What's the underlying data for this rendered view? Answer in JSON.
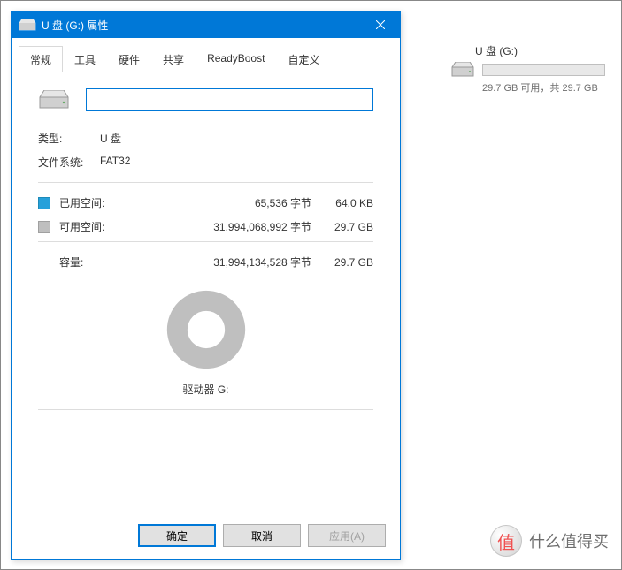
{
  "dialog": {
    "title": "U 盘 (G:) 属性",
    "tabs": [
      "常规",
      "工具",
      "硬件",
      "共享",
      "ReadyBoost",
      "自定义"
    ],
    "activeTab": 0,
    "nameValue": "",
    "typeLabel": "类型:",
    "typeValue": "U 盘",
    "fsLabel": "文件系统:",
    "fsValue": "FAT32",
    "usedLabel": "已用空间:",
    "usedBytes": "65,536 字节",
    "usedUnit": "64.0 KB",
    "freeLabel": "可用空间:",
    "freeBytes": "31,994,068,992 字节",
    "freeUnit": "29.7 GB",
    "capLabel": "容量:",
    "capBytes": "31,994,134,528 字节",
    "capUnit": "29.7 GB",
    "driveLabel": "驱动器 G:",
    "ok": "确定",
    "cancel": "取消",
    "apply": "应用(A)",
    "colors": {
      "used": "#26a0da",
      "free": "#bfbfbf"
    }
  },
  "explorer": {
    "driveTitle": "U 盘 (G:)",
    "driveSub": "29.7 GB 可用，共 29.7 GB"
  },
  "watermark": "什么值得买",
  "chart_data": {
    "type": "pie",
    "title": "驱动器 G:",
    "series": [
      {
        "name": "已用空间",
        "value": 65536,
        "unit": "字节",
        "display": "64.0 KB",
        "color": "#26a0da"
      },
      {
        "name": "可用空间",
        "value": 31994068992,
        "unit": "字节",
        "display": "29.7 GB",
        "color": "#bfbfbf"
      }
    ],
    "total": {
      "name": "容量",
      "value": 31994134528,
      "unit": "字节",
      "display": "29.7 GB"
    }
  }
}
